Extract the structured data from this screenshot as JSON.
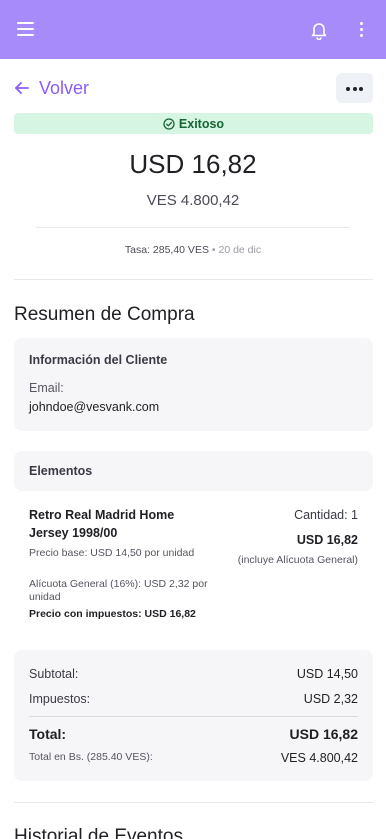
{
  "header": {
    "menu_icon": "hamburger-menu-icon",
    "notifications_icon": "bell-icon",
    "overflow_icon": "vertical-dots-icon",
    "background_color": "#a78bfa"
  },
  "nav": {
    "back_label": "Volver",
    "more_icon": "horizontal-dots-icon"
  },
  "status": {
    "label": "Exitoso",
    "icon": "check-circle-icon",
    "color": "#166534"
  },
  "amounts": {
    "usd": "USD 16,82",
    "ves": "VES 4.800,42",
    "rate": "Tasa: 285,40 VES",
    "separator": "•",
    "date": "20 de dic"
  },
  "summary": {
    "title": "Resumen de Compra",
    "customer": {
      "heading": "Información del Cliente",
      "email_label": "Email:",
      "email": "johndoe@vesvank.com"
    },
    "items": {
      "heading": "Elementos",
      "list": [
        {
          "name": "Retro Real Madrid Home Jersey 1998/00",
          "base_price": "Precio base: USD 14,50 por unidad",
          "tax_rate": "Alícuota General (16%): USD 2,32 por unidad",
          "price_with_tax": "Precio con impuestos: USD 16,82",
          "quantity": "Cantidad: 1",
          "total": "USD 16,82",
          "tax_note": "(incluye Alícuota General)"
        }
      ]
    },
    "totals": {
      "subtotal_label": "Subtotal:",
      "subtotal": "USD 14,50",
      "taxes_label": "Impuestos:",
      "taxes": "USD 2,32",
      "total_label": "Total:",
      "total": "USD 16,82",
      "total_bs_label": "Total en Bs. (285.40 VES):",
      "total_bs": "VES 4.800,42"
    }
  },
  "history": {
    "title": "Historial de Eventos"
  }
}
